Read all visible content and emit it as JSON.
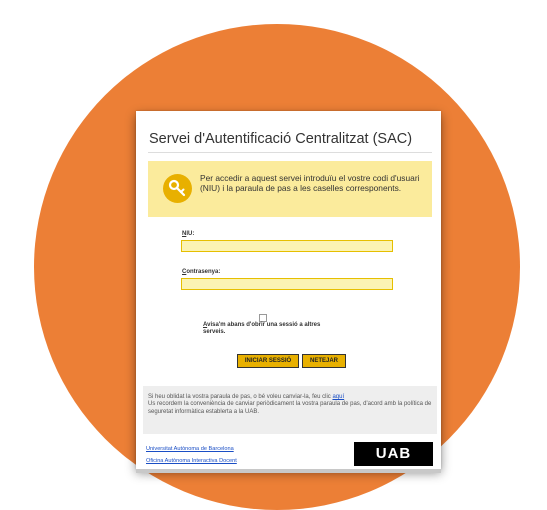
{
  "card": {
    "title": "Servei d'Autentificació Centralitzat (SAC)",
    "info_text": "Per accedir a aquest servei introduïu el vostre codi d'usuari (NIU) i la paraula de pas a les caselles corresponents.",
    "niu_label_u": "N",
    "niu_label_rest": "IU:",
    "niu_value": "",
    "password_label_u": "C",
    "password_label_rest": "ontrasenya:",
    "password_value": "",
    "remember_u": "A",
    "remember_rest": "visa'm abans d'obrir una sessió a altres serveis.",
    "remember_checked": false,
    "login_button": "INICIAR SESSIÓ",
    "clear_button": "NETEJAR",
    "notice_line1": "Si heu oblidat la vostra paraula de pas, o bé voleu canviar-la, feu clic",
    "notice_link": "aquí",
    "notice_line2": "Us recordem la conveniència de canviar periòdicament la vostra paraula de pas, d'acord amb la política de seguretat informàtica establerta a la UAB.",
    "footer_link_1": "Universitat Autònoma de Barcelona",
    "footer_link_2": "Oficina Autònoma Interactiva Docent",
    "logo_text": "UAB"
  },
  "colors": {
    "orange_circle": "#ec7f36",
    "info_box": "#fbeb9c",
    "key_badge": "#e8b000",
    "input_fill": "#fbf3b3",
    "input_border": "#e6bf00",
    "button": "#e8b000",
    "link": "#1a4ec5"
  },
  "icons": {
    "info": "key-icon"
  }
}
